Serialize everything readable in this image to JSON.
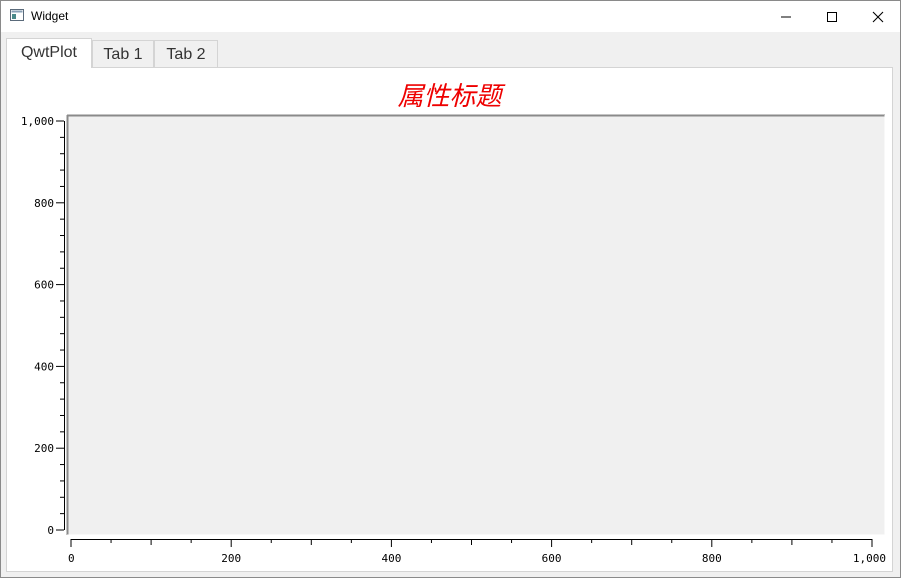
{
  "window": {
    "title": "Widget"
  },
  "tabs": [
    {
      "label": "QwtPlot",
      "active": true
    },
    {
      "label": "Tab 1",
      "active": false
    },
    {
      "label": "Tab 2",
      "active": false
    }
  ],
  "chart_data": {
    "type": "scatter",
    "title": "属性标题",
    "title_color": "#ee0000",
    "canvas_color": "#f0f0f0",
    "xlabel": "",
    "ylabel": "",
    "xlim": [
      0,
      1000
    ],
    "ylim": [
      0,
      1000
    ],
    "x_ticks": [
      "0",
      "200",
      "400",
      "600",
      "800",
      "1,000"
    ],
    "y_ticks": [
      "0",
      "200",
      "400",
      "600",
      "800",
      "1,000"
    ],
    "series": [],
    "grid": false
  }
}
